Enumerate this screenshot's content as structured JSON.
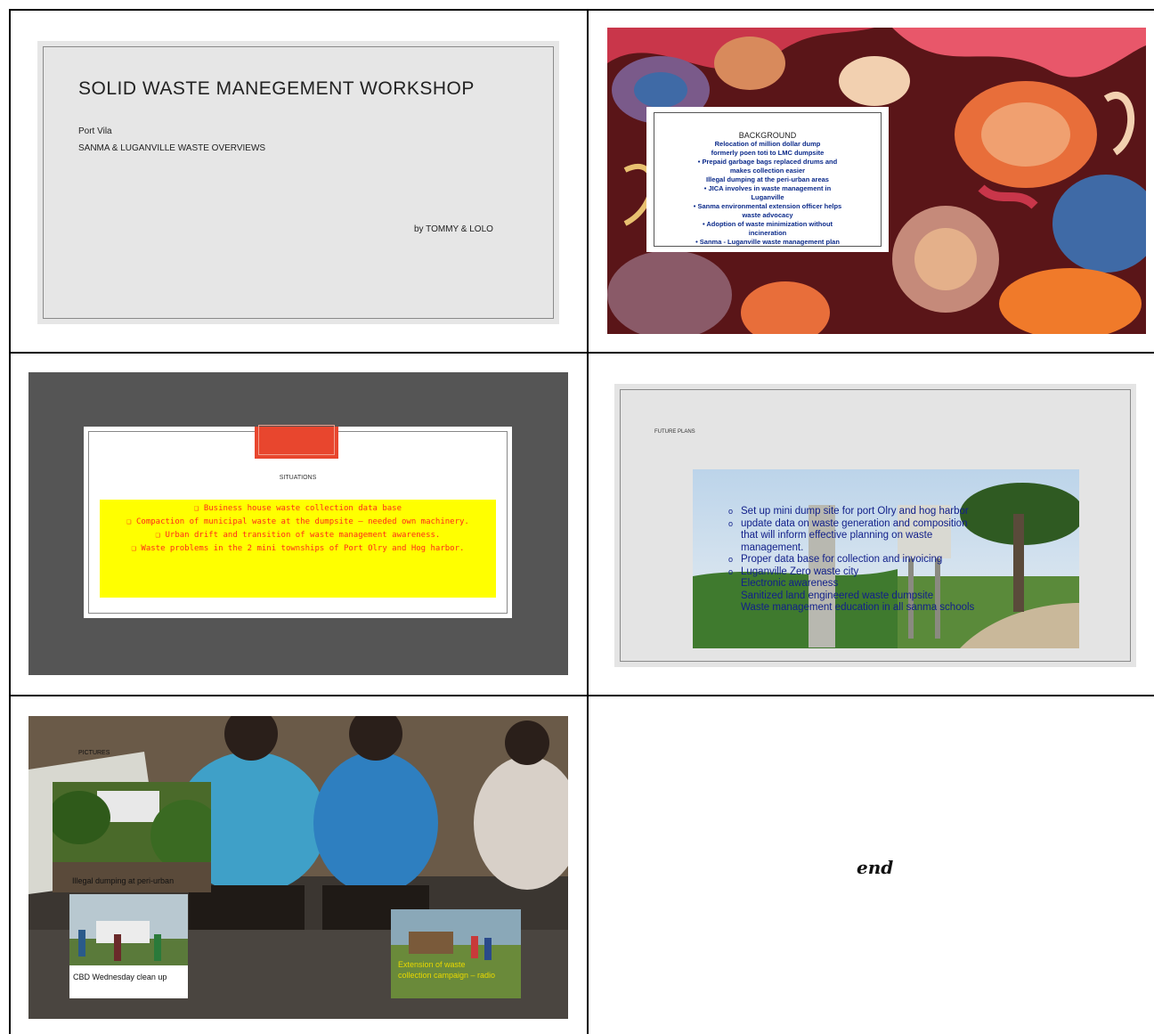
{
  "slide1": {
    "title": "SOLID WASTE MANEGEMENT WORKSHOP",
    "subtitle_line1": "Port Vila",
    "subtitle_line2": "SANMA & LUGANVILLE WASTE OVERVIEWS",
    "byline": "by TOMMY & LOLO"
  },
  "slide2": {
    "heading": "BACKGROUND",
    "lines": [
      "Relocation of million dollar dump",
      "formerly poen toti to LMC dumpsite",
      "•  Prepaid garbage bags replaced drums and",
      "makes collection easier",
      "Illegal dumping at the peri-urban areas",
      "•  JICA involves in waste management in",
      "Luganville",
      "•  Sanma environmental extension officer helps",
      "waste advocacy",
      "•  Adoption of waste minimization without",
      "incineration",
      "•  Sanma - Luganville waste management plan"
    ]
  },
  "slide3": {
    "heading": "SITUATIONS",
    "items": [
      "❑ Business house waste collection data base",
      "❑ Compaction of municipal waste at the dumpsite – needed own machinery.",
      "❑ Urban drift and transition of waste management awareness.",
      "❑ Waste problems in the 2 mini townships of Port Olry and Hog harbor."
    ]
  },
  "slide4": {
    "heading": "FUTURE PLANS",
    "items": [
      {
        "bullet": "o",
        "text": "Set up mini dump site for port Olry and hog harbor"
      },
      {
        "bullet": "o",
        "text": "update data on waste generation and composition"
      },
      {
        "bullet": "",
        "text": "that will inform effective planning on waste"
      },
      {
        "bullet": "",
        "text": "management."
      },
      {
        "bullet": "o",
        "text": "Proper data base for collection and invoicing"
      },
      {
        "bullet": "o",
        "text": "Luganville Zero waste city"
      },
      {
        "bullet": "",
        "text": "Electronic awareness"
      },
      {
        "bullet": "",
        "text": "Sanitized land engineered waste dumpsite"
      },
      {
        "bullet": "",
        "text": "Waste management education in all sanma schools"
      }
    ]
  },
  "slide5": {
    "heading": "PICTURES",
    "captions": [
      "Illegal dumping at peri-urban",
      "CBD Wednesday clean up",
      "Extension of waste collection campaign – radio"
    ]
  },
  "end_text": "end",
  "colors": {
    "slide3_bg": "#555555",
    "slide3_tab": "#e8462e",
    "slide3_highlight": "#ffff00",
    "slide3_text": "#ff2a1a",
    "slide4_text": "#12208a"
  }
}
